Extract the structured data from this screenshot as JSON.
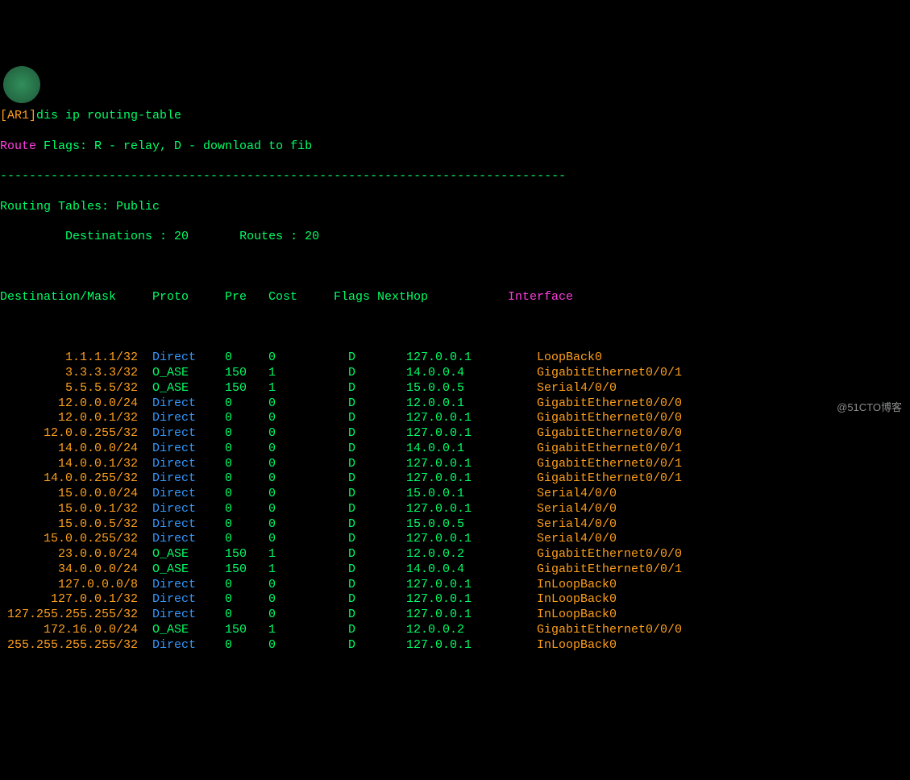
{
  "top_orange_fragment": "[AR1]",
  "command": "dis ip routing-table",
  "route_label": "Route",
  "flags_legend": " Flags: R - relay, D - download to fib",
  "divider": "------------------------------------------------------------------------------",
  "routing_tables_label": "Routing Tables: Public",
  "destinations_label": "         Destinations : ",
  "destinations_value": "20",
  "routes_label": "       Routes : ",
  "routes_value": "20",
  "headers": {
    "destination": "Destination/Mask",
    "proto": "Proto",
    "pre": "Pre",
    "cost": "Cost",
    "flags": "Flags ",
    "nexthop": "NextHop",
    "interface": "Interface"
  },
  "rows": [
    {
      "dest": "1.1.1.1/32",
      "proto": "Direct",
      "pre": "0",
      "cost": "0",
      "flags": "D",
      "nexthop": "127.0.0.1",
      "iface": "LoopBack0"
    },
    {
      "dest": "3.3.3.3/32",
      "proto": "O_ASE",
      "pre": "150",
      "cost": "1",
      "flags": "D",
      "nexthop": "14.0.0.4",
      "iface": "GigabitEthernet0/0/1"
    },
    {
      "dest": "5.5.5.5/32",
      "proto": "O_ASE",
      "pre": "150",
      "cost": "1",
      "flags": "D",
      "nexthop": "15.0.0.5",
      "iface": "Serial4/0/0"
    },
    {
      "dest": "12.0.0.0/24",
      "proto": "Direct",
      "pre": "0",
      "cost": "0",
      "flags": "D",
      "nexthop": "12.0.0.1",
      "iface": "GigabitEthernet0/0/0"
    },
    {
      "dest": "12.0.0.1/32",
      "proto": "Direct",
      "pre": "0",
      "cost": "0",
      "flags": "D",
      "nexthop": "127.0.0.1",
      "iface": "GigabitEthernet0/0/0"
    },
    {
      "dest": "12.0.0.255/32",
      "proto": "Direct",
      "pre": "0",
      "cost": "0",
      "flags": "D",
      "nexthop": "127.0.0.1",
      "iface": "GigabitEthernet0/0/0"
    },
    {
      "dest": "14.0.0.0/24",
      "proto": "Direct",
      "pre": "0",
      "cost": "0",
      "flags": "D",
      "nexthop": "14.0.0.1",
      "iface": "GigabitEthernet0/0/1"
    },
    {
      "dest": "14.0.0.1/32",
      "proto": "Direct",
      "pre": "0",
      "cost": "0",
      "flags": "D",
      "nexthop": "127.0.0.1",
      "iface": "GigabitEthernet0/0/1"
    },
    {
      "dest": "14.0.0.255/32",
      "proto": "Direct",
      "pre": "0",
      "cost": "0",
      "flags": "D",
      "nexthop": "127.0.0.1",
      "iface": "GigabitEthernet0/0/1"
    },
    {
      "dest": "15.0.0.0/24",
      "proto": "Direct",
      "pre": "0",
      "cost": "0",
      "flags": "D",
      "nexthop": "15.0.0.1",
      "iface": "Serial4/0/0"
    },
    {
      "dest": "15.0.0.1/32",
      "proto": "Direct",
      "pre": "0",
      "cost": "0",
      "flags": "D",
      "nexthop": "127.0.0.1",
      "iface": "Serial4/0/0"
    },
    {
      "dest": "15.0.0.5/32",
      "proto": "Direct",
      "pre": "0",
      "cost": "0",
      "flags": "D",
      "nexthop": "15.0.0.5",
      "iface": "Serial4/0/0"
    },
    {
      "dest": "15.0.0.255/32",
      "proto": "Direct",
      "pre": "0",
      "cost": "0",
      "flags": "D",
      "nexthop": "127.0.0.1",
      "iface": "Serial4/0/0"
    },
    {
      "dest": "23.0.0.0/24",
      "proto": "O_ASE",
      "pre": "150",
      "cost": "1",
      "flags": "D",
      "nexthop": "12.0.0.2",
      "iface": "GigabitEthernet0/0/0"
    },
    {
      "dest": "34.0.0.0/24",
      "proto": "O_ASE",
      "pre": "150",
      "cost": "1",
      "flags": "D",
      "nexthop": "14.0.0.4",
      "iface": "GigabitEthernet0/0/1"
    },
    {
      "dest": "127.0.0.0/8",
      "proto": "Direct",
      "pre": "0",
      "cost": "0",
      "flags": "D",
      "nexthop": "127.0.0.1",
      "iface": "InLoopBack0"
    },
    {
      "dest": "127.0.0.1/32",
      "proto": "Direct",
      "pre": "0",
      "cost": "0",
      "flags": "D",
      "nexthop": "127.0.0.1",
      "iface": "InLoopBack0"
    },
    {
      "dest": "127.255.255.255/32",
      "proto": "Direct",
      "pre": "0",
      "cost": "0",
      "flags": "D",
      "nexthop": "127.0.0.1",
      "iface": "InLoopBack0"
    },
    {
      "dest": "172.16.0.0/24",
      "proto": "O_ASE",
      "pre": "150",
      "cost": "1",
      "flags": "D",
      "nexthop": "12.0.0.2",
      "iface": "GigabitEthernet0/0/0"
    },
    {
      "dest": "255.255.255.255/32",
      "proto": "Direct",
      "pre": "0",
      "cost": "0",
      "flags": "D",
      "nexthop": "127.0.0.1",
      "iface": "InLoopBack0"
    }
  ],
  "watermark": "@51CTO博客"
}
